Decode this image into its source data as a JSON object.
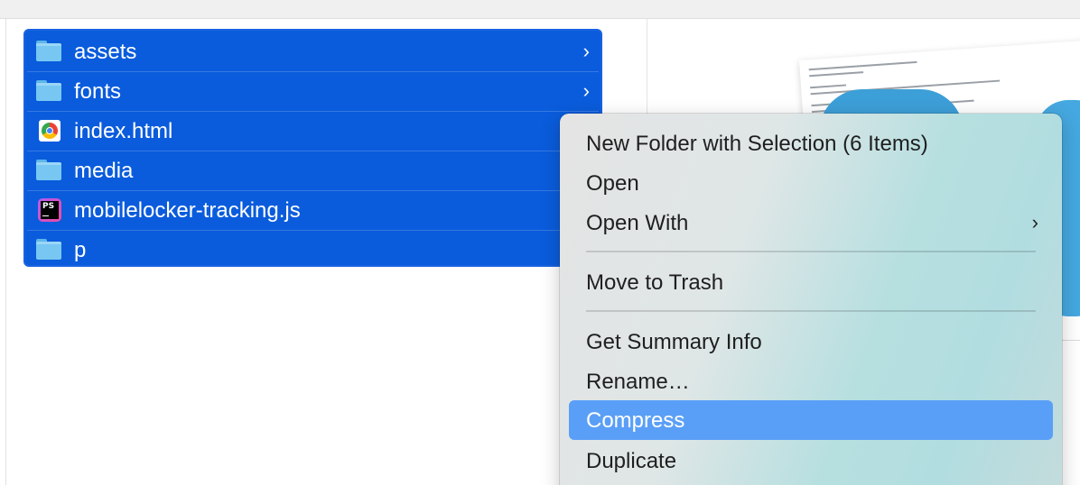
{
  "files": [
    {
      "name": "assets",
      "icon": "folder-icon",
      "has_children": true,
      "chevron": "›"
    },
    {
      "name": "fonts",
      "icon": "folder-icon",
      "has_children": true,
      "chevron": "›"
    },
    {
      "name": "index.html",
      "icon": "chrome-icon",
      "has_children": false
    },
    {
      "name": "media",
      "icon": "folder-icon",
      "has_children": false
    },
    {
      "name": "mobilelocker-tracking.js",
      "icon": "phpstorm-icon",
      "icon_text": "PS",
      "has_children": false
    },
    {
      "name": "p",
      "icon": "folder-icon",
      "has_children": false
    }
  ],
  "context_menu": {
    "items": [
      {
        "label": "New Folder with Selection (6 Items)"
      },
      {
        "label": "Open"
      },
      {
        "label": "Open With",
        "submenu": true,
        "chevron": "›"
      },
      {
        "label": "Move to Trash"
      },
      {
        "label": "Get Summary Info"
      },
      {
        "label": "Rename…"
      },
      {
        "label": "Compress",
        "highlighted": true
      },
      {
        "label": "Duplicate"
      }
    ]
  },
  "colors": {
    "selection": "#0a5cdc",
    "menu_highlight": "#5a9ff7",
    "folder": "#78c7f2"
  }
}
